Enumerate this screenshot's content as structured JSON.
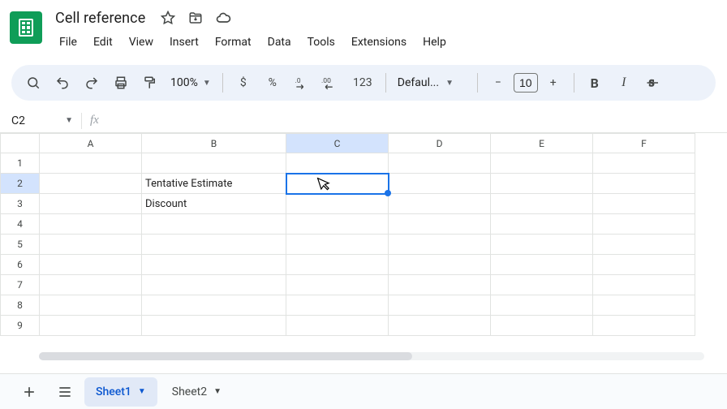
{
  "doc": {
    "title": "Cell reference"
  },
  "menus": {
    "file": "File",
    "edit": "Edit",
    "view": "View",
    "insert": "Insert",
    "format": "Format",
    "data": "Data",
    "tools": "Tools",
    "extensions": "Extensions",
    "help": "Help"
  },
  "toolbar": {
    "zoom": "100%",
    "currency": "$",
    "percent": "%",
    "dec_dec": ".0",
    "dec_inc": ".00",
    "num_fmt": "123",
    "font": "Defaul...",
    "minus": "−",
    "plus": "+",
    "size": "10",
    "bold": "B",
    "italic": "I"
  },
  "fxrow": {
    "namebox": "C2",
    "fx": "fx"
  },
  "grid": {
    "columns": [
      "A",
      "B",
      "C",
      "D",
      "E",
      "F"
    ],
    "rows": [
      "1",
      "2",
      "3",
      "4",
      "5",
      "6",
      "7",
      "8",
      "9"
    ],
    "selected_col": "C",
    "selected_row": "2",
    "cells": {
      "B2": "Tentative Estimate",
      "B3": "Discount"
    }
  },
  "sheets": {
    "active": "Sheet1",
    "other": "Sheet2"
  }
}
